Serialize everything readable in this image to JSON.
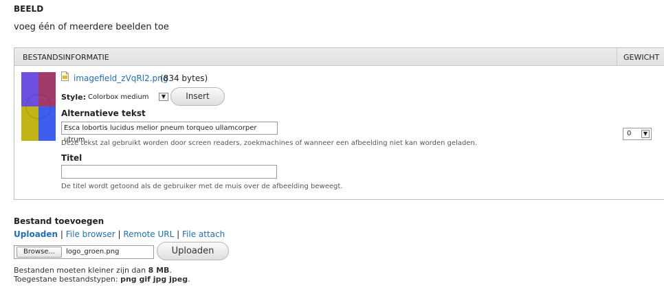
{
  "section": {
    "title": "BEELD",
    "description": "voeg één of meerdere beelden toe"
  },
  "table": {
    "header_file_info": "BESTANDSINFORMATIE",
    "header_weight": "GEWICHT",
    "row": {
      "file_name": "imagefield_zVqRl2.png",
      "file_size": "(834 bytes)",
      "style_label": "Style:",
      "style_value": "Colorbox medium",
      "insert_label": "Insert",
      "alt_label": "Alternatieve tekst",
      "alt_value": "Esca lobortis lucidus melior pneum torqueo ullamcorper utrum.",
      "alt_help": "Deze tekst zal gebruikt worden door screen readers, zoekmachines of wanneer een afbeelding niet kan worden geladen.",
      "title_label": "Titel",
      "title_value": "",
      "title_help": "De titel wordt getoond als de gebruiker met de muis over de afbeelding beweegt.",
      "weight_value": "0"
    }
  },
  "add_file": {
    "title": "Bestand toevoegen",
    "tabs": [
      {
        "label": "Uploaden",
        "active": true
      },
      {
        "label": "File browser",
        "active": false
      },
      {
        "label": "Remote URL",
        "active": false
      },
      {
        "label": "File attach",
        "active": false
      }
    ],
    "separator": "|",
    "browse_label": "Browse...",
    "chosen_file": "logo_groen.png",
    "upload_label": "Uploaden",
    "limit_text": "Bestanden moeten kleiner zijn dan ",
    "limit_value": "8 MB",
    "limit_suffix": ".",
    "types_text": "Toegestane bestandstypen: ",
    "types_value": "png gif jpg jpeg",
    "types_suffix": "."
  },
  "colors": {
    "link": "#1e6fb5",
    "thumb_purple": "#6c4fe0",
    "thumb_maroon": "#a23a6a",
    "thumb_olive": "#c2b414",
    "thumb_blue": "#3f5ef0"
  },
  "icons": [
    "image-file-icon",
    "chevron-down-icon"
  ]
}
